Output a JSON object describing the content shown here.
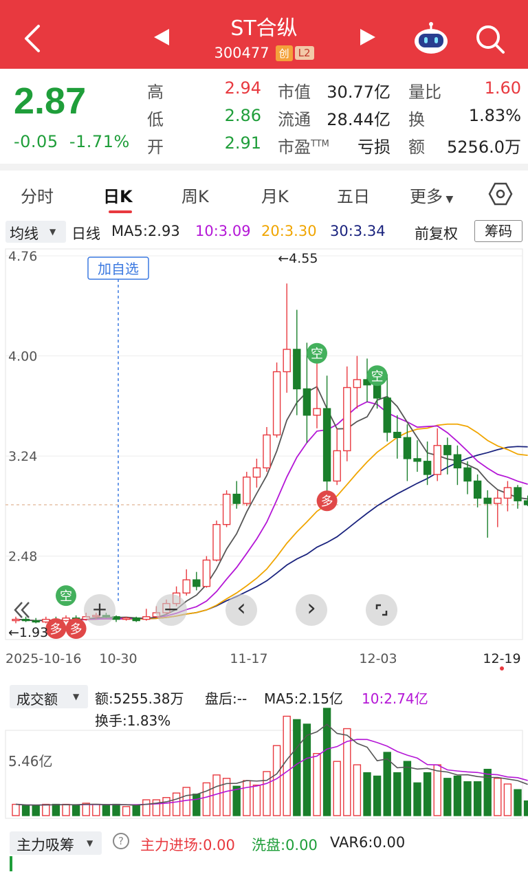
{
  "header": {
    "title": "ST合纵",
    "code": "300477",
    "badge1": "创",
    "badge2": "L2"
  },
  "quote": {
    "price": "2.87",
    "change": "-0.05",
    "change_pct": "-1.71%",
    "high_label": "高",
    "high": "2.94",
    "low_label": "低",
    "low": "2.86",
    "open_label": "开",
    "open": "2.91",
    "mcap_label": "市值",
    "mcap": "30.77亿",
    "float_label": "流通",
    "float": "28.44亿",
    "pe_label": "市盈",
    "pe_sup": "TTM",
    "pe": "亏损",
    "vr_label": "量比",
    "vr": "1.60",
    "turnover_label": "换",
    "turnover": "1.83%",
    "amount_label": "额",
    "amount": "5256.0万"
  },
  "tabs": [
    "分时",
    "日K",
    "周K",
    "月K",
    "五日",
    "更多"
  ],
  "ma_bar": {
    "dropdown": "均线",
    "period": "日线",
    "ma5": "MA5:2.93",
    "ma10": "10:3.09",
    "ma20": "20:3.30",
    "ma30": "30:3.34",
    "adjust": "前复权",
    "chips": "筹码"
  },
  "colors": {
    "up": "#e8393f",
    "down": "#1a7f2b",
    "ma5": "#555555",
    "ma10": "#b416d6",
    "ma20": "#f0a500",
    "ma30": "#1a237e"
  },
  "chart_labels": {
    "y_ticks": [
      "4.76",
      "4.00",
      "3.24",
      "2.48"
    ],
    "max_note": "←4.55",
    "min_note": "←1.93",
    "add_watch": "加自选",
    "x_labels": [
      "2025-10-16",
      "10-30",
      "11-17",
      "12-03",
      "12-19"
    ],
    "sig_kong": "空",
    "sig_duo": "多"
  },
  "controls": {
    "zoom_in": "+",
    "zoom_out": "−",
    "prev": "‹",
    "next": "›"
  },
  "chart_data": {
    "type": "candlestick",
    "y_ticks": [
      4.76,
      4.0,
      3.24,
      2.48
    ],
    "ylim": [
      1.93,
      4.76
    ],
    "candles": [
      [
        1.99,
        2.0,
        2.02,
        1.97
      ],
      [
        2.0,
        1.99,
        2.02,
        1.98
      ],
      [
        1.99,
        1.98,
        2.01,
        1.97
      ],
      [
        1.98,
        2.0,
        2.02,
        1.97
      ],
      [
        2.0,
        1.99,
        2.02,
        1.97
      ],
      [
        1.99,
        2.01,
        2.03,
        1.98
      ],
      [
        2.01,
        2.0,
        2.03,
        1.99
      ],
      [
        2.0,
        2.02,
        2.05,
        1.99
      ],
      [
        2.02,
        2.03,
        2.05,
        2.0
      ],
      [
        2.03,
        2.02,
        2.05,
        2.01
      ],
      [
        2.02,
        2.0,
        2.03,
        1.98
      ],
      [
        2.0,
        2.01,
        2.02,
        1.99
      ],
      [
        2.01,
        1.99,
        2.02,
        1.98
      ],
      [
        2.0,
        2.02,
        2.08,
        1.99
      ],
      [
        2.02,
        2.05,
        2.1,
        2.01
      ],
      [
        2.05,
        2.12,
        2.15,
        2.04
      ],
      [
        2.12,
        2.2,
        2.25,
        2.1
      ],
      [
        2.2,
        2.3,
        2.38,
        2.18
      ],
      [
        2.3,
        2.25,
        2.36,
        2.22
      ],
      [
        2.25,
        2.45,
        2.48,
        2.24
      ],
      [
        2.45,
        2.72,
        2.75,
        2.44
      ],
      [
        2.72,
        2.95,
        2.98,
        2.7
      ],
      [
        2.95,
        2.88,
        3.05,
        2.84
      ],
      [
        2.88,
        3.08,
        3.12,
        2.86
      ],
      [
        3.08,
        3.15,
        3.22,
        3.0
      ],
      [
        3.15,
        3.4,
        3.46,
        3.12
      ],
      [
        3.4,
        3.88,
        3.95,
        3.38
      ],
      [
        3.88,
        4.05,
        4.55,
        3.72
      ],
      [
        4.05,
        3.75,
        4.35,
        3.55
      ],
      [
        3.75,
        3.55,
        4.1,
        3.34
      ],
      [
        3.55,
        3.6,
        3.95,
        3.45
      ],
      [
        3.6,
        3.05,
        3.85,
        2.95
      ],
      [
        3.05,
        3.28,
        3.45,
        3.02
      ],
      [
        3.28,
        3.76,
        3.92,
        3.2
      ],
      [
        3.76,
        3.82,
        4.0,
        3.6
      ],
      [
        3.82,
        3.78,
        3.98,
        3.65
      ],
      [
        3.78,
        3.68,
        3.9,
        3.6
      ],
      [
        3.68,
        3.42,
        3.86,
        3.35
      ],
      [
        3.42,
        3.38,
        3.55,
        3.22
      ],
      [
        3.38,
        3.22,
        3.48,
        3.05
      ],
      [
        3.22,
        3.2,
        3.36,
        3.12
      ],
      [
        3.2,
        3.1,
        3.35,
        3.02
      ],
      [
        3.1,
        3.32,
        3.45,
        3.05
      ],
      [
        3.32,
        3.25,
        3.38,
        3.1
      ],
      [
        3.25,
        3.15,
        3.32,
        3.02
      ],
      [
        3.15,
        3.05,
        3.2,
        2.95
      ],
      [
        3.05,
        2.92,
        3.1,
        2.85
      ],
      [
        2.92,
        2.88,
        2.98,
        2.62
      ],
      [
        2.88,
        2.92,
        2.98,
        2.7
      ],
      [
        2.92,
        3.0,
        3.05,
        2.82
      ],
      [
        3.0,
        2.9,
        3.02,
        2.84
      ],
      [
        2.9,
        2.87,
        2.94,
        2.86
      ]
    ],
    "volume": {
      "label": "成交额",
      "amount": "额:5255.38万",
      "after": "盘后:--",
      "ma5": "MA5:2.15亿",
      "ma10": "10:2.74亿",
      "turnover": "换手:1.83%",
      "y_tick": "5.46亿"
    }
  },
  "indicator": {
    "dropdown": "主力吸筹",
    "help": "?",
    "main_in": "主力进场:0.00",
    "wash": "洗盘:0.00",
    "var6": "VAR6:0.00"
  }
}
